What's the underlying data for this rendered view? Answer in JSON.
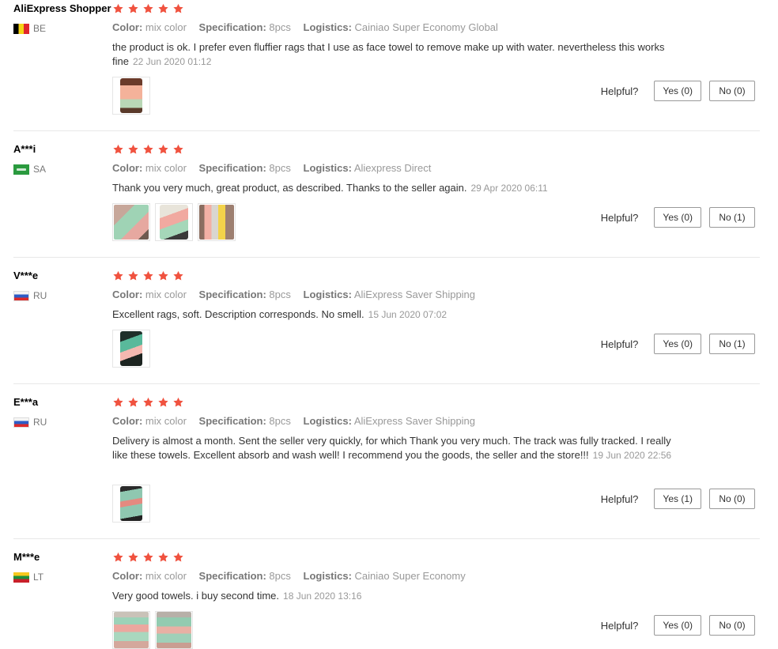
{
  "labels": {
    "color": "Color:",
    "specification": "Specification:",
    "logistics": "Logistics:",
    "helpful": "Helpful?"
  },
  "colors": {
    "star": "#f0523f",
    "bg": "#ffffff",
    "separator": "#e8e8e8"
  },
  "reviews": [
    {
      "user": "AliExpress Shopper",
      "country": "BE",
      "flag": "be-flag",
      "rating": 5,
      "color": "mix color",
      "specification": "8pcs",
      "logistics": "Cainiao Super Economy Global",
      "feedback": "the product is ok. I prefer even fluffier rags that I use as face towel to remove make up with water. nevertheless this works fine",
      "date": "22 Jun 2020 01:12",
      "yes": "Yes (0)",
      "no": "No (0)"
    },
    {
      "user": "A***i",
      "country": "SA",
      "flag": "sa-flag",
      "rating": 5,
      "color": "mix color",
      "specification": "8pcs",
      "logistics": "Aliexpress Direct",
      "feedback": "Thank you very much, great product, as described. Thanks to the seller again.",
      "date": "29 Apr 2020 06:11",
      "yes": "Yes (0)",
      "no": "No (1)"
    },
    {
      "user": "V***e",
      "country": "RU",
      "flag": "ru-flag",
      "rating": 5,
      "color": "mix color",
      "specification": "8pcs",
      "logistics": "AliExpress Saver Shipping",
      "feedback": "Excellent rags, soft. Description corresponds. No smell.",
      "date": "15 Jun 2020 07:02",
      "yes": "Yes (0)",
      "no": "No (1)"
    },
    {
      "user": "E***a",
      "country": "RU",
      "flag": "ru-flag",
      "rating": 5,
      "color": "mix color",
      "specification": "8pcs",
      "logistics": "AliExpress Saver Shipping",
      "feedback": "Delivery is almost a month. Sent the seller very quickly, for which Thank you very much. The track was fully tracked. I really like these towels. Excellent absorb and wash well! I recommend you the goods, the seller and the store!!!",
      "date": "19 Jun 2020 22:56",
      "yes": "Yes (1)",
      "no": "No (0)"
    },
    {
      "user": "M***e",
      "country": "LT",
      "flag": "lt-flag",
      "rating": 5,
      "color": "mix color",
      "specification": "8pcs",
      "logistics": "Cainiao Super Economy",
      "feedback": "Very good towels. i buy second time.",
      "date": "18 Jun 2020 13:16",
      "yes": "Yes (0)",
      "no": "No (0)"
    }
  ]
}
